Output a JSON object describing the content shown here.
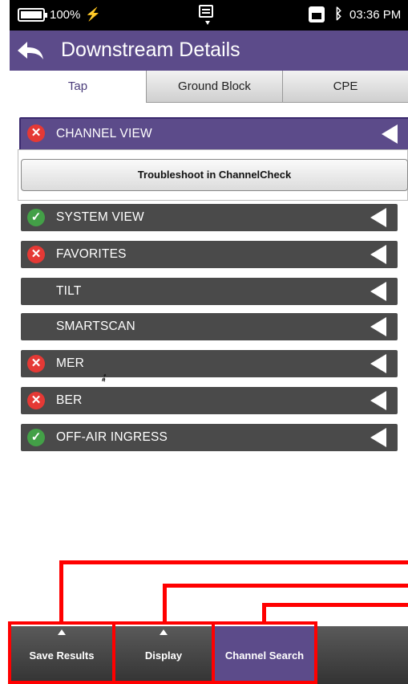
{
  "status_bar": {
    "battery": "100%",
    "time": "03:36 PM",
    "icons": [
      "battery-icon",
      "charging-bolt-icon",
      "keyboard-icon",
      "ethernet-icon",
      "bluetooth-icon"
    ]
  },
  "header": {
    "title": "Downstream Details",
    "back_icon": "back-arrow-icon"
  },
  "tabs": [
    {
      "label": "Tap",
      "active": true
    },
    {
      "label": "Ground Block",
      "active": false
    },
    {
      "label": "CPE",
      "active": false
    }
  ],
  "troubleshoot_button": "Troubleshoot in ChannelCheck",
  "rows": [
    {
      "label": "CHANNEL VIEW",
      "status": "fail",
      "selected": true
    },
    {
      "label": "SYSTEM VIEW",
      "status": "pass"
    },
    {
      "label": "FAVORITES",
      "status": "fail"
    },
    {
      "label": "TILT",
      "status": "none"
    },
    {
      "label": "SMARTSCAN",
      "status": "none"
    },
    {
      "label": "MER",
      "status": "fail"
    },
    {
      "label": "BER",
      "status": "fail"
    },
    {
      "label": "OFF-AIR INGRESS",
      "status": "pass"
    }
  ],
  "toolbar": {
    "save_results": "Save Results",
    "display": "Display",
    "channel_search": "Channel Search"
  },
  "colors": {
    "accent": "#5c4b8a",
    "row_bg": "#4a4a4a",
    "fail": "#e53935",
    "pass": "#43a047",
    "annotation": "#ff0000"
  }
}
